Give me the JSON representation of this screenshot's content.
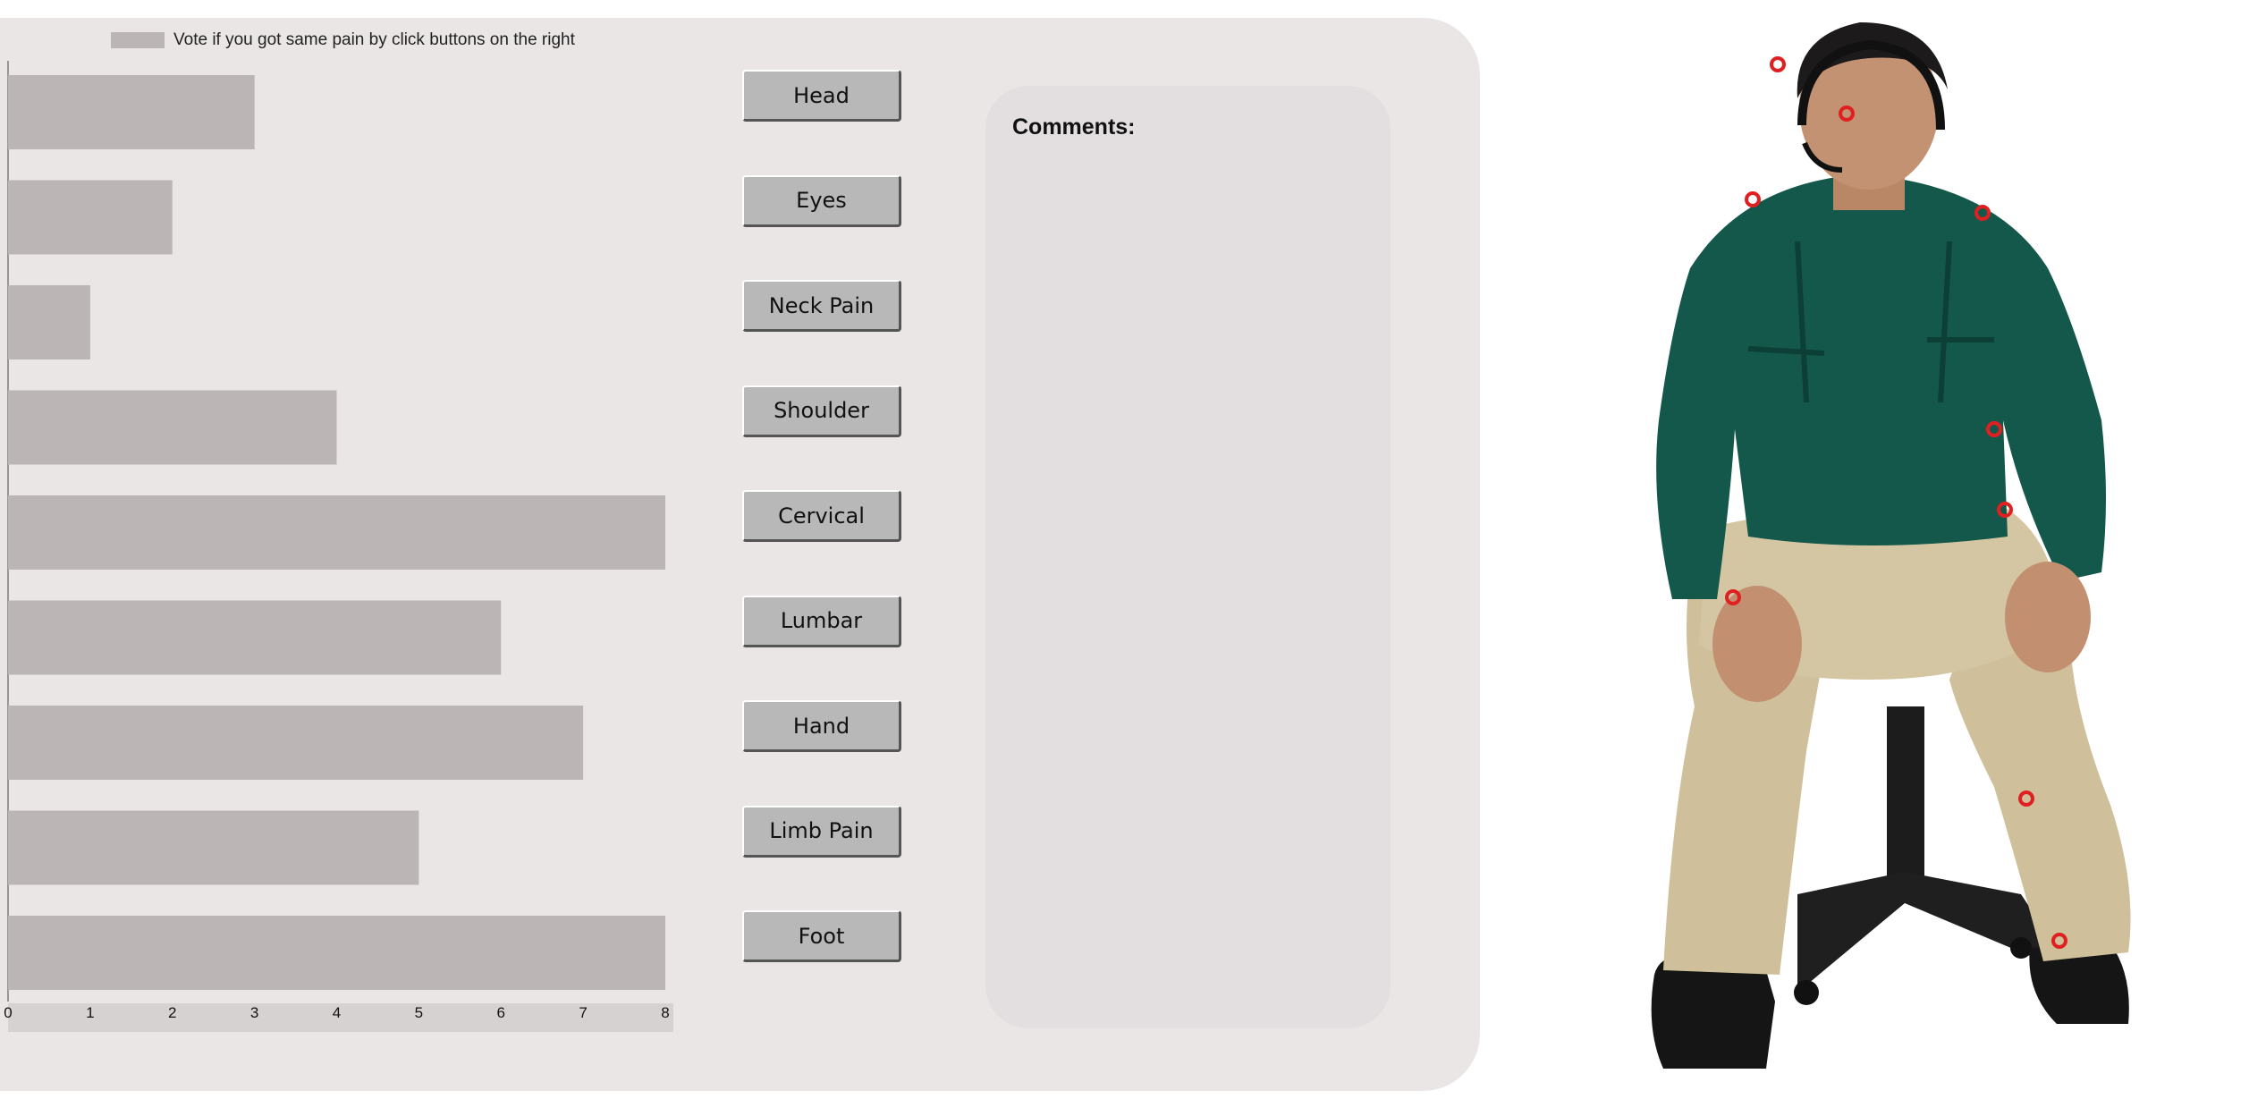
{
  "legend": {
    "label": "Vote if you got same pain by click buttons on the right",
    "color": "#bbb5b5"
  },
  "chart_data": {
    "type": "bar",
    "orientation": "horizontal",
    "categories": [
      "Head",
      "Eyes",
      "Neck Pain",
      "Shoulder",
      "Cervical",
      "Lumbar",
      "Hand",
      "Limb Pain",
      "Foot"
    ],
    "values": [
      3,
      2,
      1,
      4,
      8,
      6,
      7,
      5,
      8
    ],
    "xlim": [
      0,
      8
    ],
    "xticks": [
      "0",
      "1",
      "2",
      "3",
      "4",
      "5",
      "6",
      "7",
      "8"
    ],
    "bar_color": "#bbb5b5",
    "legend_position": "top-left",
    "grid": false
  },
  "buttons": [
    "Head",
    "Eyes",
    "Neck Pain",
    "Shoulder",
    "Cervical",
    "Lumbar",
    "Hand",
    "Limb Pain",
    "Foot"
  ],
  "comments": {
    "label": "Comments:"
  },
  "figure": {
    "icon": "seated-person-illustration",
    "marker_color": "#e02020",
    "shirt_color": "#13584a",
    "pants_color": "#cfc09b"
  }
}
